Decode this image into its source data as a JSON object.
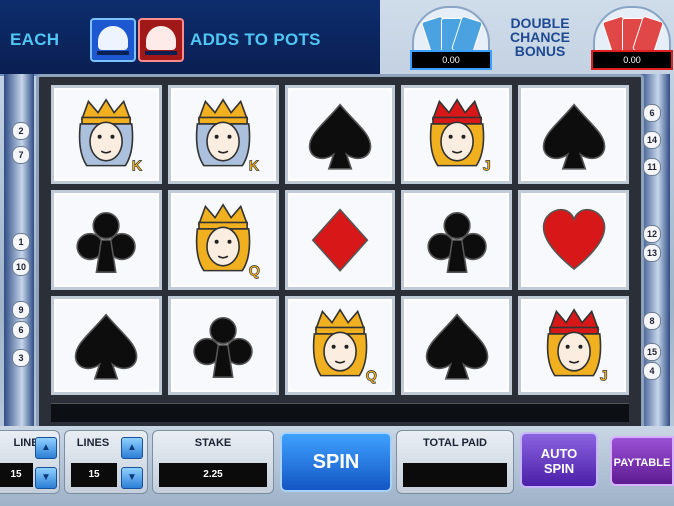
{
  "banner": {
    "each_label": "EACH",
    "adds_label": "ADDS TO POTS",
    "double_chance_line1": "DOUBLE",
    "double_chance_line2": "CHANCE",
    "double_chance_line3": "BONUS",
    "blue_pot_value": "0.00",
    "red_pot_value": "0.00"
  },
  "reels": [
    [
      "king",
      "king",
      "spade",
      "jack",
      "spade"
    ],
    [
      "club",
      "queen",
      "diamond",
      "club",
      "heart"
    ],
    [
      "spade",
      "club",
      "queen",
      "spade",
      "jack"
    ]
  ],
  "card_letters": {
    "king": "K",
    "queen": "Q",
    "jack": "J"
  },
  "paylines_left": [
    "2",
    "7",
    "1",
    "10",
    "9",
    "6",
    "3"
  ],
  "paylines_right": [
    "6",
    "14",
    "11",
    "12",
    "13",
    "8",
    "15",
    "4"
  ],
  "controls": {
    "line_label": "LINE",
    "line_value": "15",
    "lines_label": "LINES",
    "lines_value": "15",
    "stake_label": "STAKE",
    "stake_value": "2.25",
    "spin_label": "SPIN",
    "total_paid_label": "TOTAL PAID",
    "total_paid_value": "",
    "auto_spin_line1": "AUTO",
    "auto_spin_line2": "SPIN",
    "paytable_label": "PAYTABLE"
  },
  "colors": {
    "accent": "#1356c4",
    "suit_red": "#d81818",
    "suit_black": "#0d0d0d",
    "gold": "#f0b020"
  }
}
